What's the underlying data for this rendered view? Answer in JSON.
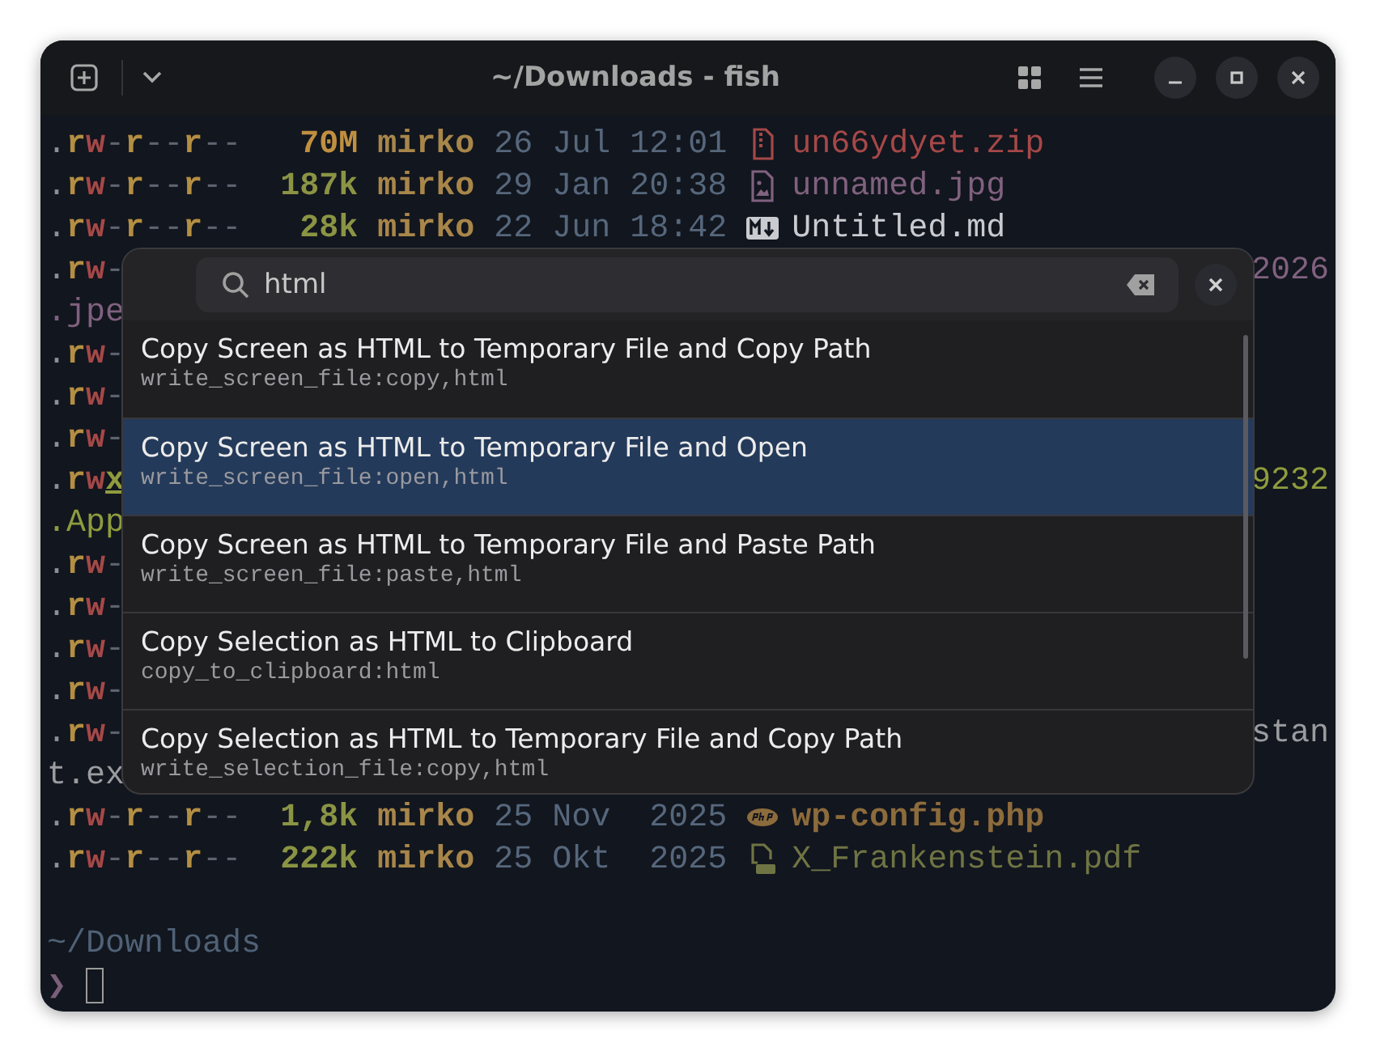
{
  "window": {
    "title": "~/Downloads - fish"
  },
  "terminal": {
    "rows": [
      {
        "kind": "full",
        "perms": [
          {
            "text": ".",
            "kind": "dot"
          },
          {
            "text": "r",
            "kind": "read"
          },
          {
            "text": "w",
            "kind": "write"
          },
          {
            "text": "-",
            "kind": "none"
          },
          {
            "text": "r",
            "kind": "read"
          },
          {
            "text": "--",
            "kind": "none"
          },
          {
            "text": "r",
            "kind": "read"
          },
          {
            "text": "--",
            "kind": "none"
          }
        ],
        "size": {
          "text": "70M",
          "kind": "mega"
        },
        "user": "mirko",
        "date": "26 Jul 12:01",
        "file": {
          "text": "un66ydyet.zip",
          "kind": "archive"
        }
      },
      {
        "kind": "full",
        "perms": [
          {
            "text": ".",
            "kind": "dot"
          },
          {
            "text": "r",
            "kind": "read"
          },
          {
            "text": "w",
            "kind": "write"
          },
          {
            "text": "-",
            "kind": "none"
          },
          {
            "text": "r",
            "kind": "read"
          },
          {
            "text": "--",
            "kind": "none"
          },
          {
            "text": "r",
            "kind": "read"
          },
          {
            "text": "--",
            "kind": "none"
          }
        ],
        "size": {
          "text": "187k",
          "kind": "kilo"
        },
        "user": "mirko",
        "date": "29 Jan 20:38",
        "file": {
          "text": "unnamed.jpg",
          "kind": "image"
        }
      },
      {
        "kind": "full",
        "perms": [
          {
            "text": ".",
            "kind": "dot"
          },
          {
            "text": "r",
            "kind": "read"
          },
          {
            "text": "w",
            "kind": "write"
          },
          {
            "text": "-",
            "kind": "none"
          },
          {
            "text": "r",
            "kind": "read"
          },
          {
            "text": "--",
            "kind": "none"
          },
          {
            "text": "r",
            "kind": "read"
          },
          {
            "text": "--",
            "kind": "none"
          }
        ],
        "size": {
          "text": "28k",
          "kind": "kilo"
        },
        "user": "mirko",
        "date": "22 Jun 18:42",
        "file": {
          "text": "Untitled.md",
          "kind": "markdown"
        }
      },
      {
        "kind": "partial",
        "perms": [
          {
            "text": ".",
            "kind": "dot"
          },
          {
            "text": "r",
            "kind": "read"
          },
          {
            "text": "w",
            "kind": "write"
          },
          {
            "text": "-",
            "kind": "none"
          }
        ],
        "right": {
          "text": "2026",
          "kind": "image"
        }
      },
      {
        "kind": "wrap",
        "fragment": {
          "text": ".jpe",
          "kind": "image"
        }
      },
      {
        "kind": "partial",
        "perms": [
          {
            "text": ".",
            "kind": "dot"
          },
          {
            "text": "r",
            "kind": "read"
          },
          {
            "text": "w",
            "kind": "write"
          },
          {
            "text": "-",
            "kind": "none"
          }
        ]
      },
      {
        "kind": "partial",
        "perms": [
          {
            "text": ".",
            "kind": "dot"
          },
          {
            "text": "r",
            "kind": "read"
          },
          {
            "text": "w",
            "kind": "write"
          },
          {
            "text": "-",
            "kind": "none"
          }
        ]
      },
      {
        "kind": "partial",
        "perms": [
          {
            "text": ".",
            "kind": "dot"
          },
          {
            "text": "r",
            "kind": "read"
          },
          {
            "text": "w",
            "kind": "write"
          },
          {
            "text": "-",
            "kind": "none"
          }
        ]
      },
      {
        "kind": "partial",
        "perms": [
          {
            "text": ".",
            "kind": "dot"
          },
          {
            "text": "r",
            "kind": "read"
          },
          {
            "text": "w",
            "kind": "write"
          },
          {
            "text": "x",
            "kind": "exec"
          }
        ],
        "right": {
          "text": "9232",
          "kind": "executable"
        }
      },
      {
        "kind": "wrap",
        "fragment": {
          "text": ".App",
          "kind": "executable"
        }
      },
      {
        "kind": "partial",
        "perms": [
          {
            "text": ".",
            "kind": "dot"
          },
          {
            "text": "r",
            "kind": "read"
          },
          {
            "text": "w",
            "kind": "write"
          },
          {
            "text": "-",
            "kind": "none"
          }
        ]
      },
      {
        "kind": "partial",
        "perms": [
          {
            "text": ".",
            "kind": "dot"
          },
          {
            "text": "r",
            "kind": "read"
          },
          {
            "text": "w",
            "kind": "write"
          },
          {
            "text": "-",
            "kind": "none"
          }
        ]
      },
      {
        "kind": "partial",
        "perms": [
          {
            "text": ".",
            "kind": "dot"
          },
          {
            "text": "r",
            "kind": "read"
          },
          {
            "text": "w",
            "kind": "write"
          },
          {
            "text": "-",
            "kind": "none"
          }
        ]
      },
      {
        "kind": "partial",
        "perms": [
          {
            "text": ".",
            "kind": "dot"
          },
          {
            "text": "r",
            "kind": "read"
          },
          {
            "text": "w",
            "kind": "write"
          },
          {
            "text": "-",
            "kind": "none"
          }
        ]
      },
      {
        "kind": "partial",
        "perms": [
          {
            "text": ".",
            "kind": "dot"
          },
          {
            "text": "r",
            "kind": "read"
          },
          {
            "text": "w",
            "kind": "write"
          },
          {
            "text": "-",
            "kind": "none"
          }
        ],
        "right": {
          "text": "stan",
          "kind": "plain"
        }
      },
      {
        "kind": "wrap",
        "fragment": {
          "text": "t.ex",
          "kind": "plain"
        }
      },
      {
        "kind": "full",
        "perms": [
          {
            "text": ".",
            "kind": "dot"
          },
          {
            "text": "r",
            "kind": "read"
          },
          {
            "text": "w",
            "kind": "write"
          },
          {
            "text": "-",
            "kind": "none"
          },
          {
            "text": "r",
            "kind": "read"
          },
          {
            "text": "--",
            "kind": "none"
          },
          {
            "text": "r",
            "kind": "read"
          },
          {
            "text": "--",
            "kind": "none"
          }
        ],
        "size": {
          "text": "1,8k",
          "kind": "kilo"
        },
        "user": "mirko",
        "date": "25 Nov  2025",
        "file": {
          "text": "wp-config.php",
          "kind": "php"
        }
      },
      {
        "kind": "full",
        "perms": [
          {
            "text": ".",
            "kind": "dot"
          },
          {
            "text": "r",
            "kind": "read"
          },
          {
            "text": "w",
            "kind": "write"
          },
          {
            "text": "-",
            "kind": "none"
          },
          {
            "text": "r",
            "kind": "read"
          },
          {
            "text": "--",
            "kind": "none"
          },
          {
            "text": "r",
            "kind": "read"
          },
          {
            "text": "--",
            "kind": "none"
          }
        ],
        "size": {
          "text": "222k",
          "kind": "kilo"
        },
        "user": "mirko",
        "date": "25 Okt  2025",
        "file": {
          "text": "X_Frankenstein.pdf",
          "kind": "pdf"
        }
      },
      {
        "kind": "blank"
      },
      {
        "kind": "path",
        "text": "~/Downloads"
      },
      {
        "kind": "prompt",
        "text": "❯"
      }
    ]
  },
  "palette": {
    "search": {
      "value": "html"
    },
    "items": [
      {
        "title": "Copy Screen as HTML to Temporary File and Copy Path",
        "action": "write_screen_file:copy,html",
        "selected": false
      },
      {
        "title": "Copy Screen as HTML to Temporary File and Open",
        "action": "write_screen_file:open,html",
        "selected": true
      },
      {
        "title": "Copy Screen as HTML to Temporary File and Paste Path",
        "action": "write_screen_file:paste,html",
        "selected": false
      },
      {
        "title": "Copy Selection as HTML to Clipboard",
        "action": "copy_to_clipboard:html",
        "selected": false
      },
      {
        "title": "Copy Selection as HTML to Temporary File and Copy Path",
        "action": "write_selection_file:copy,html",
        "selected": false
      }
    ]
  }
}
